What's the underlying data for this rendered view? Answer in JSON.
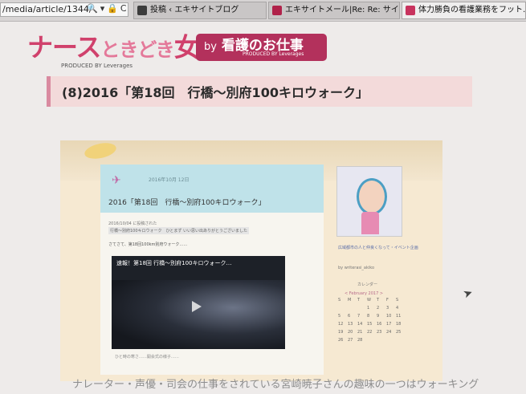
{
  "browser": {
    "address": "/media/article/1344/",
    "address_icons": "🔍▾🔒C",
    "tabs": [
      {
        "label": "投稿 ‹ エキサイトブログ",
        "color": "#3c3c3c"
      },
      {
        "label": "エキサイトメール|Re: Re: サイトご紹…",
        "color": "#b0224a"
      },
      {
        "label": "体力勝負の看護業務をフット…",
        "color": "#c8335e"
      }
    ]
  },
  "site": {
    "logo_part1": "ナース",
    "logo_part2": "ときどき",
    "logo_part3": "女子",
    "logo_sub": "PRODUCED BY Leverages",
    "badge_by": "by",
    "badge_main": "看護のお仕事",
    "badge_sub": "PRODUCED BY Leverages"
  },
  "article": {
    "title": "(8)2016「第18回　行橋〜別府100キロウォーク」"
  },
  "blog": {
    "date": "2016年10月 12日",
    "post_title": "2016「第18回　行橋〜別府100キロウォーク」",
    "meta1": "2016/10/04 に投稿された",
    "meta2": "行橋〜別府100キロウォーク　ひとまず いい思い出ありがとうございました",
    "intro": "さてさて、第18回100km別府ウォーク……",
    "video_title": "速報！第18回 行橋〜別府100キロウォーク…",
    "caption": "ひと時の寒さ……開会式の様子……",
    "sidebar_link": "広域都市の人と仲良くなって・イベント企画",
    "sidebar_by": "by writerasi_akiko",
    "calendar_label": "カレンダー",
    "calendar_month": "< February 2017 >",
    "calendar_days": [
      "S",
      "M",
      "T",
      "W",
      "T",
      "F",
      "S",
      "",
      "",
      "",
      "1",
      "2",
      "3",
      "4",
      "5",
      "6",
      "7",
      "8",
      "9",
      "10",
      "11",
      "12",
      "13",
      "14",
      "15",
      "16",
      "17",
      "18",
      "19",
      "20",
      "21",
      "22",
      "23",
      "24",
      "25",
      "26",
      "27",
      "28",
      "",
      "",
      "",
      ""
    ]
  },
  "below_text": "ナレーター・声優・司会の仕事をされている宮崎暁子さんの趣味の一つはウォーキング"
}
